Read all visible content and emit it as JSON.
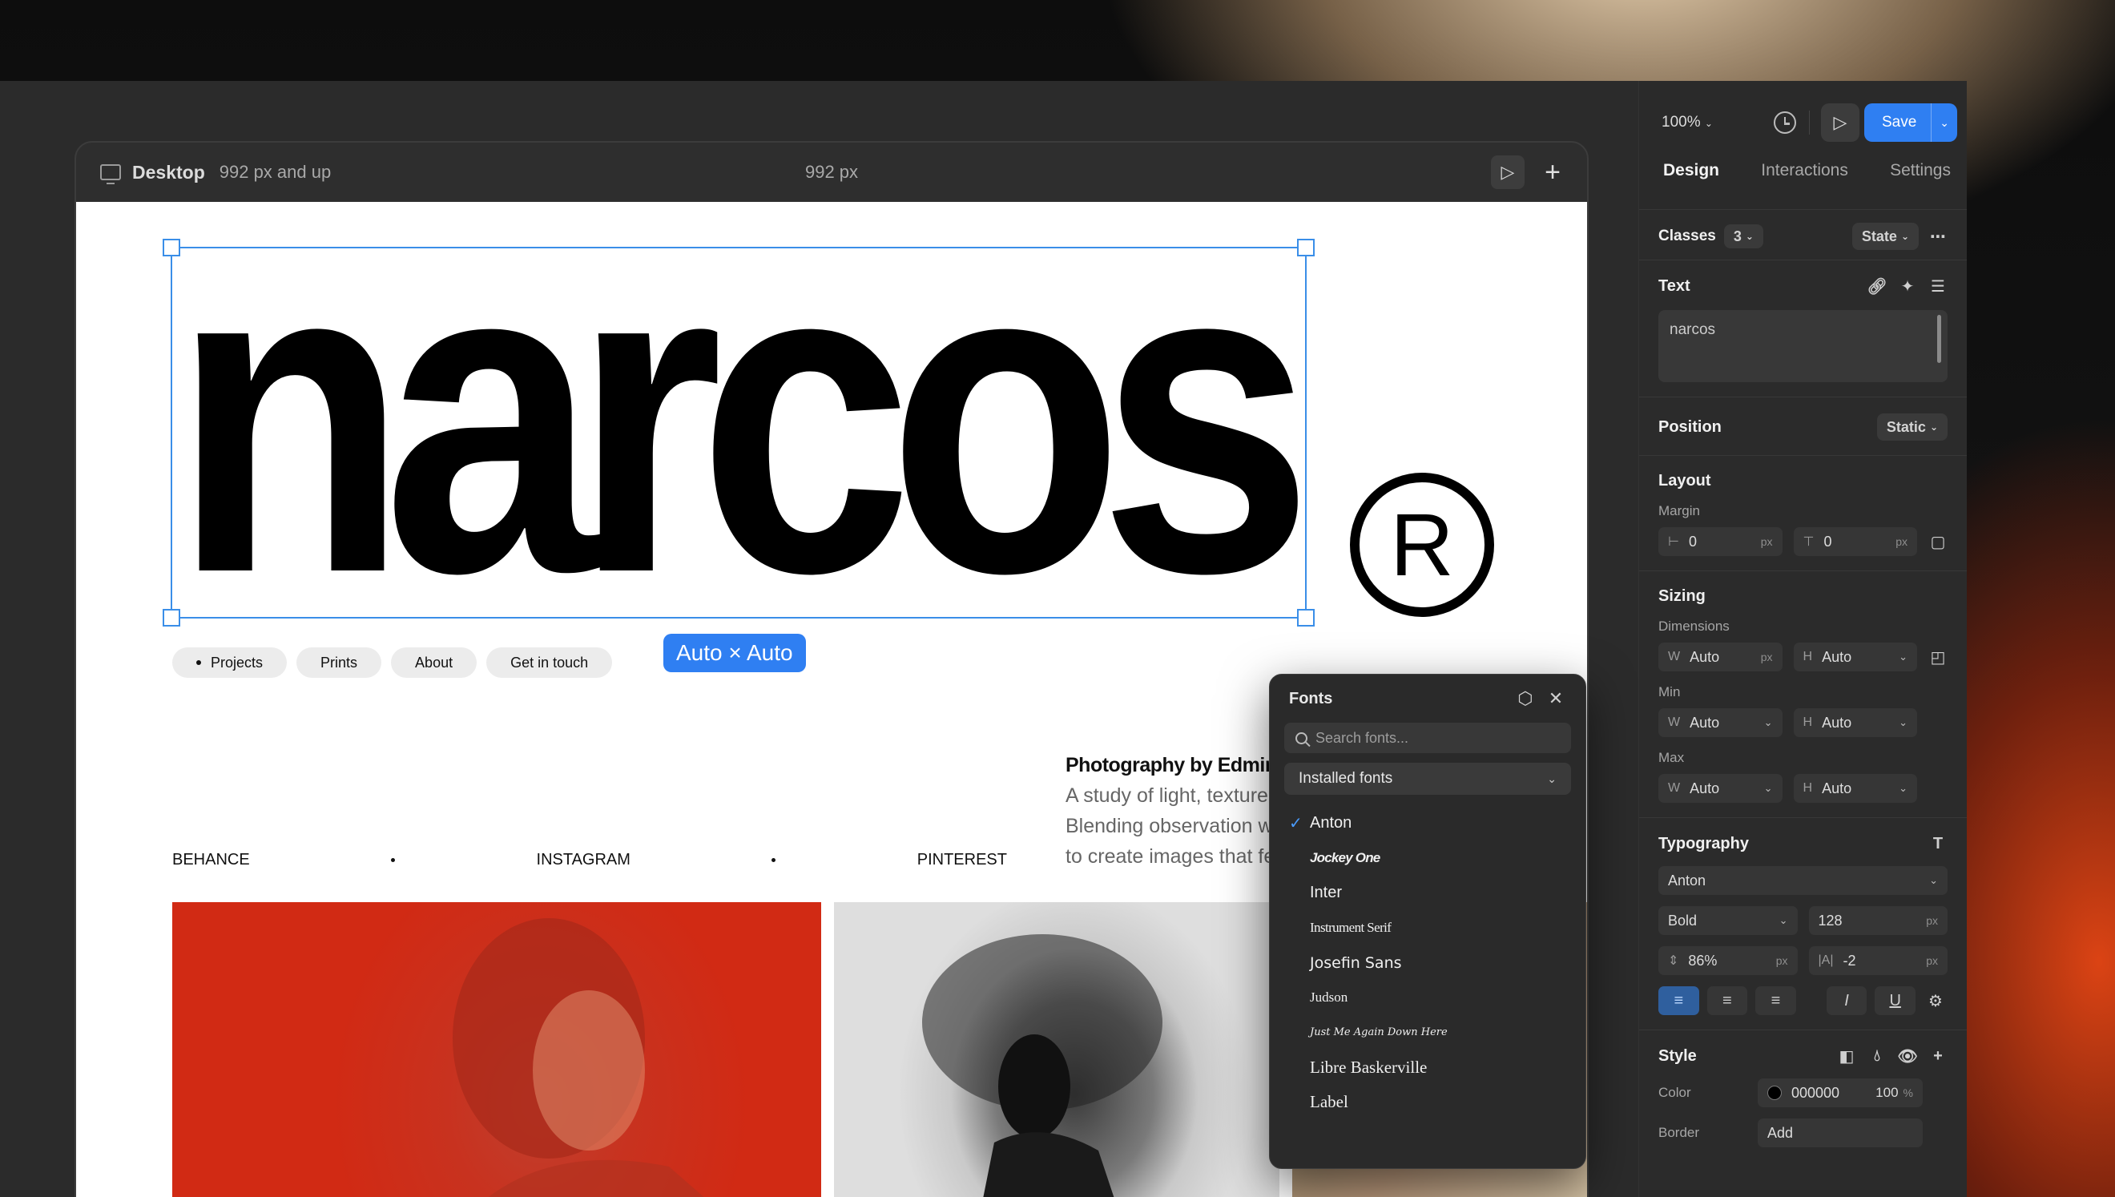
{
  "frame": {
    "title": "Desktop",
    "breakpoint": "992 px and up",
    "width_label": "992 px",
    "play_icon": "play-icon",
    "add_icon": "plus-icon"
  },
  "canvas": {
    "logo": "narcos",
    "registered": "R",
    "size_badge": "Auto × Auto",
    "nav": [
      "Projects",
      "Prints",
      "About",
      "Get in touch"
    ],
    "about_heading": "Photography by Edmin",
    "about_lines": [
      "A study of light, texture,",
      "Blending observation wi",
      "to create images that fe"
    ],
    "socials": [
      "BEHANCE",
      "INSTAGRAM",
      "PINTEREST"
    ]
  },
  "fonts_popup": {
    "title": "Fonts",
    "search_placeholder": "Search fonts...",
    "source": "Installed fonts",
    "selected": "Anton",
    "fonts": [
      "Anton",
      "Jockey One",
      "Inter",
      "Instrument Serif",
      "Josefin Sans",
      "Judson",
      "Just Me Again Down Here",
      "Libre Baskerville",
      "Label"
    ]
  },
  "sidebar": {
    "zoom": "100%",
    "save": "Save",
    "tabs": [
      "Design",
      "Interactions",
      "Settings"
    ],
    "classes": {
      "label": "Classes",
      "count": "3",
      "state": "State"
    },
    "text": {
      "label": "Text",
      "value": "narcos"
    },
    "position": {
      "label": "Position",
      "value": "Static"
    },
    "layout": {
      "label": "Layout",
      "margin_label": "Margin",
      "margin_h": "0",
      "margin_v": "0",
      "unit": "px"
    },
    "sizing": {
      "label": "Sizing",
      "dimensions_label": "Dimensions",
      "w": "Auto",
      "h": "Auto",
      "w_pre": "W",
      "h_pre": "H",
      "min_label": "Min",
      "min_w": "Auto",
      "min_h": "Auto",
      "max_label": "Max",
      "max_w": "Auto",
      "max_h": "Auto",
      "unit": "px"
    },
    "typography": {
      "label": "Typography",
      "font": "Anton",
      "weight": "Bold",
      "size": "128",
      "line_height": "86%",
      "letter_spacing": "-2",
      "unit": "px"
    },
    "style": {
      "label": "Style",
      "color_label": "Color",
      "color_hex": "000000",
      "opacity": "100",
      "pct": "%",
      "border_label": "Border",
      "border_add": "Add"
    }
  },
  "colors": {
    "accent": "#2f7ff2",
    "selection": "#3a8ee8"
  }
}
